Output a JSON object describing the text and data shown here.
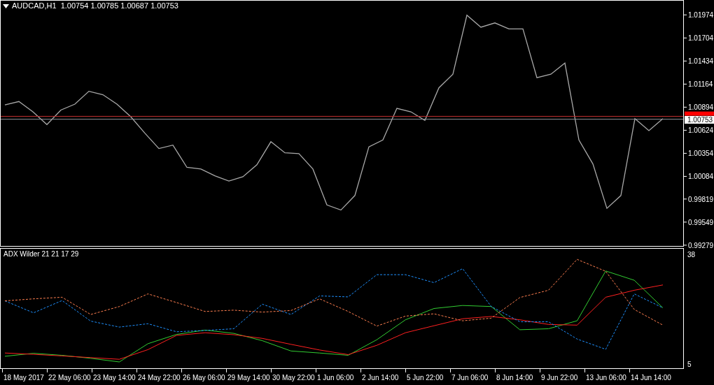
{
  "price_chart": {
    "header": "AUDCAD,H1  1.00754 1.00785 1.00687 1.00753",
    "current_price": "1.00753",
    "chart_data": {
      "type": "line",
      "ylim": [
        0.9927,
        1.0214
      ],
      "yticks": [
        1.01974,
        1.01704,
        1.01434,
        1.01164,
        1.00894,
        1.00624,
        1.00354,
        1.00084,
        0.99819,
        0.99549,
        0.99279
      ],
      "ref_lines": [
        {
          "axis": "y",
          "value": 1.00787,
          "color": "#c03030"
        },
        {
          "axis": "y",
          "value": 1.00753,
          "color": "#8a8f99"
        }
      ],
      "series": [
        {
          "color": "#a8a8a8",
          "values": [
            1.0092,
            1.0096,
            1.0084,
            1.0069,
            1.0086,
            1.0093,
            1.0108,
            1.0104,
            1.0093,
            1.0078,
            1.0059,
            1.0041,
            1.0045,
            1.0019,
            1.0017,
            1.0009,
            1.0003,
            1.0008,
            1.0022,
            1.0049,
            1.0036,
            1.0035,
            1.0017,
            0.9975,
            0.9969,
            0.9986,
            1.0043,
            1.0051,
            1.0088,
            1.0084,
            1.0074,
            1.0112,
            1.0128,
            1.0197,
            1.0183,
            1.0188,
            1.0181,
            1.0181,
            1.0124,
            1.0128,
            1.0141,
            1.0051,
            1.0023,
            0.9971,
            0.9986,
            1.0076,
            1.0062,
            1.0076
          ]
        }
      ]
    }
  },
  "indicator": {
    "label": "ADX Wilder 21 21 17 29",
    "time_axis": [
      "18 May 2017",
      "22 May 06:00",
      "23 May 14:00",
      "24 May 22:00",
      "26 May 06:00",
      "29 May 14:00",
      "30 May 22:00",
      "1 Jun 06:00",
      "2 Jun 14:00",
      "5 Jun 22:00",
      "7 Jun 06:00",
      "8 Jun 14:00",
      "9 Jun 22:00",
      "13 Jun 06:00",
      "14 Jun 14:00"
    ],
    "chart_data": {
      "type": "line",
      "ylim": [
        3.7,
        39.7
      ],
      "yticks": [
        38,
        5
      ],
      "series": [
        {
          "color": "#32cd32",
          "line_style": "solid",
          "values": [
            7.3,
            8.2,
            7.6,
            6.7,
            5.6,
            11.1,
            13.9,
            15.2,
            14.2,
            12.0,
            8.9,
            8.3,
            7.6,
            12.3,
            18.3,
            21.7,
            22.6,
            22.3,
            15.3,
            15.6,
            18.0,
            33.0,
            30.2,
            21.9
          ]
        },
        {
          "color": "#ff2020",
          "line_style": "solid",
          "values": [
            8.3,
            7.9,
            7.4,
            6.9,
            6.4,
            9.3,
            13.6,
            14.4,
            13.8,
            12.7,
            10.9,
            9.2,
            7.8,
            10.6,
            14.4,
            16.5,
            18.6,
            19.3,
            18.3,
            16.9,
            16.7,
            25.1,
            27.2,
            28.8
          ]
        },
        {
          "color": "#1e90ff",
          "line_style": "dashed",
          "values": [
            24.0,
            20.4,
            24.1,
            17.9,
            16.1,
            17.1,
            14.7,
            15.1,
            15.6,
            23.0,
            19.9,
            25.5,
            25.2,
            31.9,
            31.9,
            29.5,
            33.7,
            22.3,
            17.7,
            17.7,
            12.5,
            9.4,
            26.1,
            21.9
          ]
        },
        {
          "color": "#ff7f50",
          "line_style": "dashed",
          "values": [
            24.0,
            24.6,
            25.1,
            19.9,
            22.3,
            26.1,
            23.5,
            20.8,
            21.2,
            20.6,
            21.1,
            24.6,
            20.8,
            16.4,
            19.4,
            20.1,
            18.0,
            18.8,
            25.0,
            27.2,
            36.5,
            32.9,
            21.4,
            16.7
          ]
        }
      ]
    }
  }
}
